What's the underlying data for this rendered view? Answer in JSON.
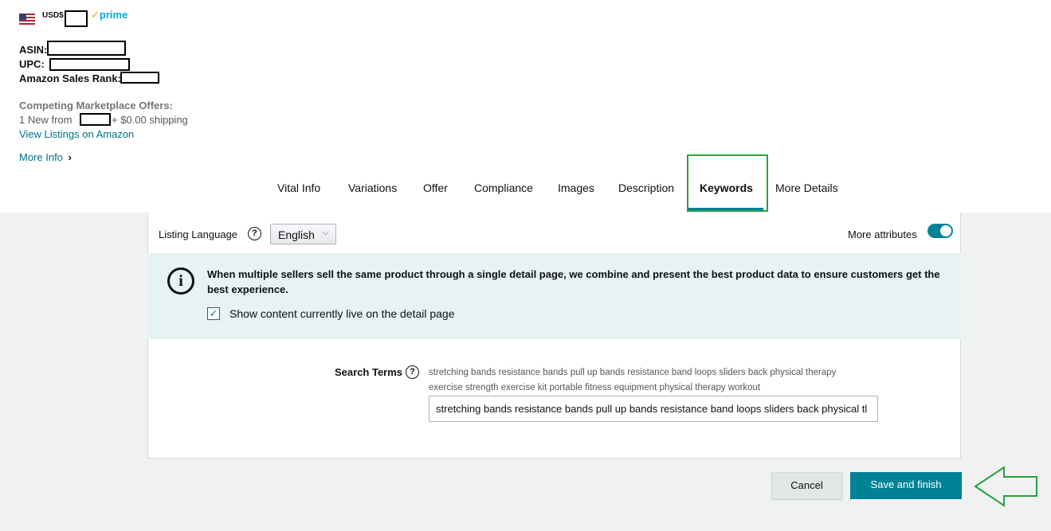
{
  "product": {
    "currency": "USD$",
    "prime_label": "prime",
    "prime_check": "✓",
    "asin_label": "ASIN:",
    "upc_label": "UPC:",
    "sales_rank_label": "Amazon Sales Rank:",
    "competing_label": "Competing Marketplace Offers:",
    "new_offers_prefix": "1 New  from",
    "shipping_text": "+ $0.00 shipping",
    "view_listings": "View Listings on Amazon",
    "more_info": "More Info",
    "more_info_chevron": "›"
  },
  "tabs": [
    {
      "label": "Vital Info"
    },
    {
      "label": "Variations"
    },
    {
      "label": "Offer"
    },
    {
      "label": "Compliance"
    },
    {
      "label": "Images"
    },
    {
      "label": "Description"
    },
    {
      "label": "Keywords",
      "active": true
    },
    {
      "label": "More Details"
    }
  ],
  "settings": {
    "listing_language_label": "Listing Language",
    "help_glyph": "?",
    "language_value": "English",
    "language_chevron": "⌵",
    "more_attributes_label": "More attributes",
    "more_attributes_on": true
  },
  "info": {
    "icon_glyph": "i",
    "message": "When multiple sellers sell the same product through a single detail page, we combine and present the best product data to ensure customers get the best experience.",
    "show_live_label": "Show content currently live on the detail page",
    "show_live_checked": true,
    "check_glyph": "✓"
  },
  "search_terms": {
    "label": "Search Terms",
    "hint": "stretching bands resistance bands pull up bands resistance band loops sliders back physical therapy exercise strength exercise kit portable fitness equipment physical therapy workout",
    "value": "stretching bands resistance bands pull up bands resistance band loops sliders back physical tl"
  },
  "actions": {
    "cancel_label": "Cancel",
    "save_label": "Save and finish"
  },
  "colors": {
    "accent": "#008296",
    "highlight": "#26a33b",
    "link": "#007185"
  }
}
